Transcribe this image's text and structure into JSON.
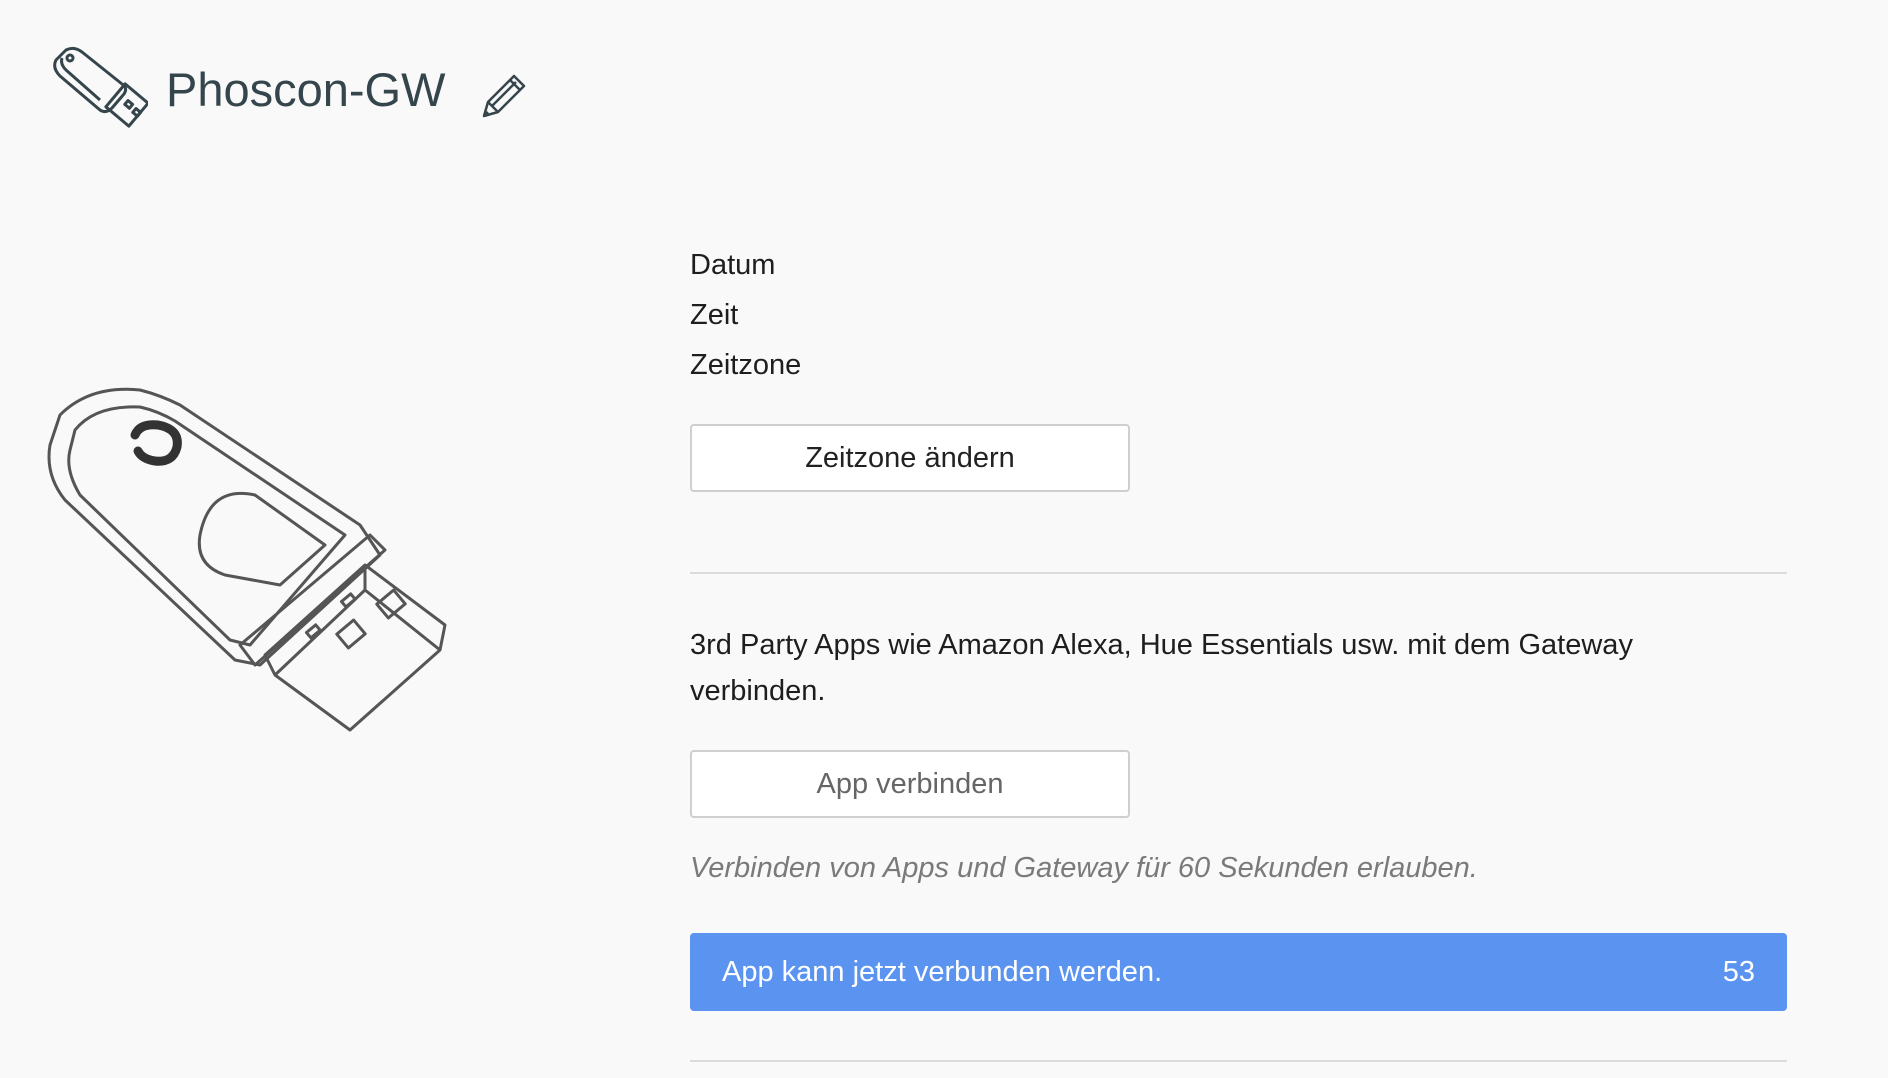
{
  "header": {
    "gateway_name": "Phoscon-GW"
  },
  "gateway_info": {
    "date_label": "Datum",
    "time_label": "Zeit",
    "timezone_label": "Zeitzone",
    "change_timezone_button": "Zeitzone ändern"
  },
  "third_party": {
    "description": "3rd Party Apps wie Amazon Alexa, Hue Essentials usw. mit dem Gateway verbinden.",
    "connect_button": "App verbinden",
    "hint": "Verbinden von Apps und Gateway für 60 Sekunden erlauben.",
    "status_message": "App kann jetzt verbunden werden.",
    "countdown": "53"
  },
  "colors": {
    "accent": "#5a94f0",
    "title": "#35454c",
    "background": "#f9f9f9"
  },
  "icons": {
    "header": "usb-stick-icon",
    "edit": "pencil-icon",
    "illustration": "usb-stick-illustration"
  }
}
